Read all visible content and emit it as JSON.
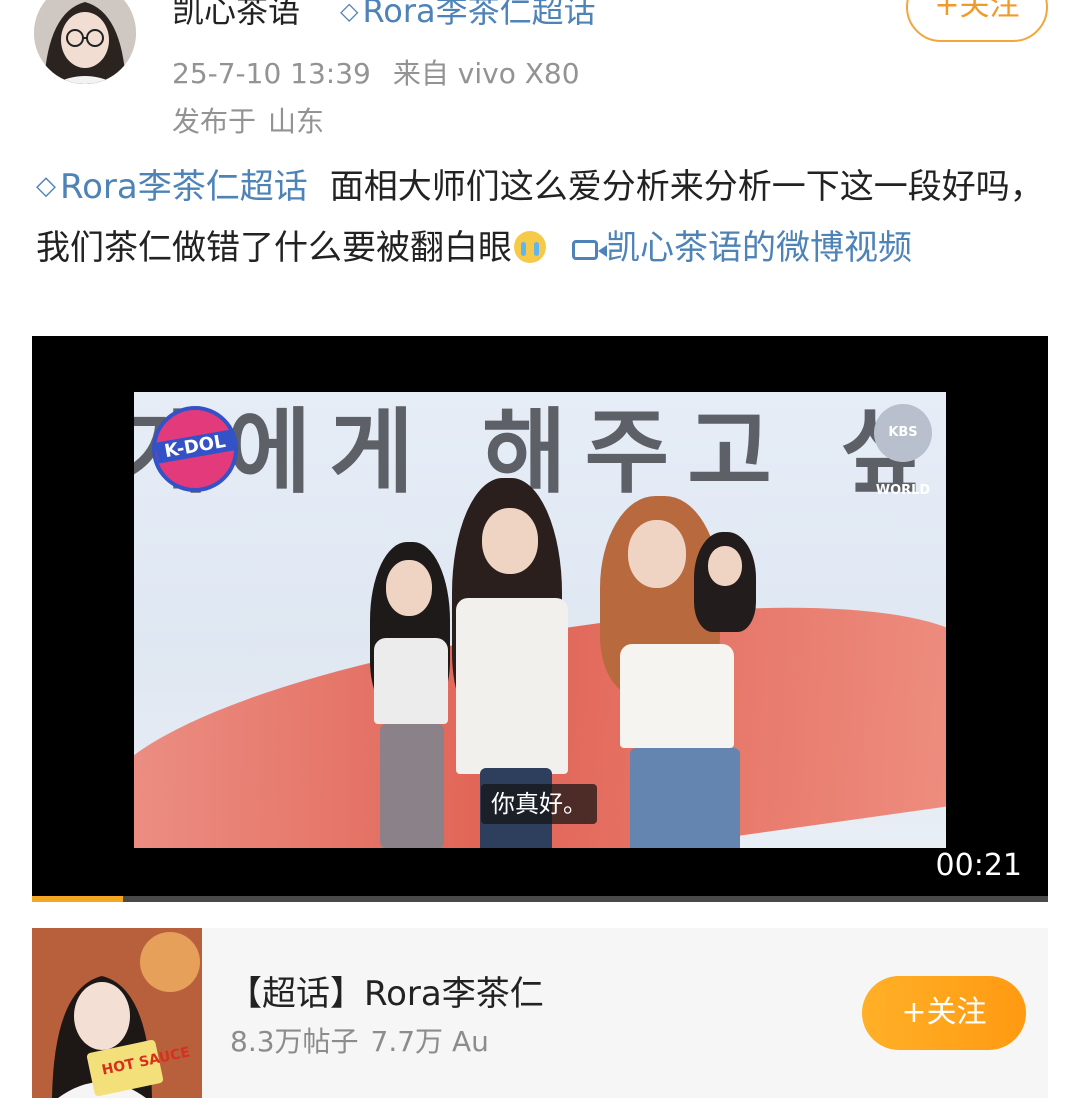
{
  "post": {
    "author": {
      "name": "凯心茶语",
      "badge": "Rora李茶仁超话"
    },
    "follow_label": "+关注",
    "meta": {
      "time": "25-7-10 13:39",
      "source": "来自 vivo X80",
      "location_label": "发布于",
      "location": "山东"
    },
    "body": {
      "topic_link": "Rora李茶仁超话",
      "text_line1": "面相大师们这么爱分析来分析一下这一段好吗，我们茶仁做错了什么要被翻白眼",
      "video_link": "凯心茶语的微博视频"
    }
  },
  "video": {
    "banner_text": "게에게 해주고 싶",
    "logo_left": "K-DOL",
    "logo_right": "KBS WORLD",
    "subtitle": "你真好。",
    "duration": "00:21",
    "progress": 0.09
  },
  "topic_card": {
    "title": "【超话】Rora李茶仁",
    "posts": "8.3万帖子",
    "fans": "7.7万 Au",
    "follow_label": "+关注",
    "thumb_text": "HOT SAUCE"
  },
  "colors": {
    "link": "#4e83b8",
    "accent": "#ff9a12",
    "meta": "#939393"
  }
}
